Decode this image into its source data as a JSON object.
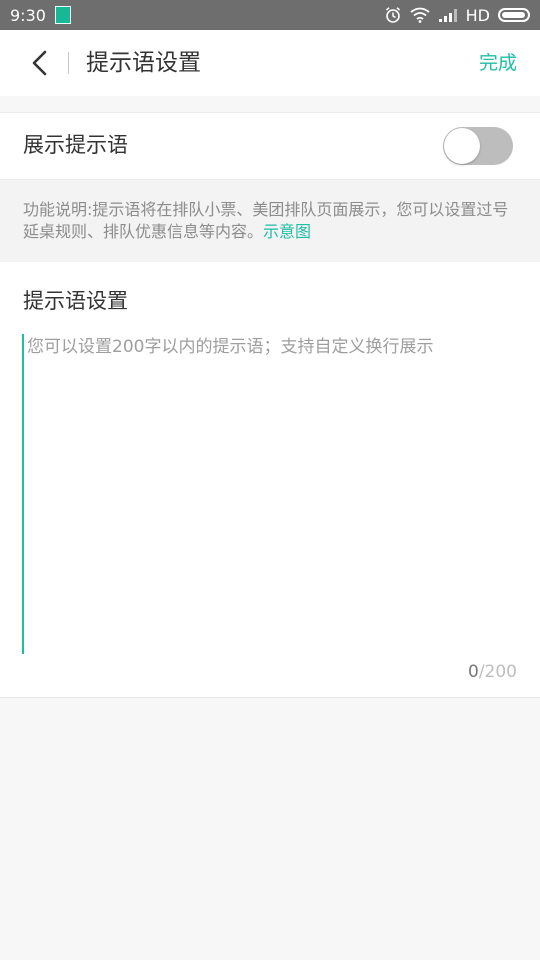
{
  "status_bar": {
    "time": "9:30",
    "network": "HD"
  },
  "nav": {
    "title": "提示语设置",
    "done_label": "完成"
  },
  "toggle_row": {
    "label": "展示提示语",
    "enabled": false
  },
  "description": {
    "text": "功能说明:提示语将在排队小票、美团排队页面展示，您可以设置过号延桌规则、排队优惠信息等内容。",
    "link_label": "示意图"
  },
  "editor": {
    "title": "提示语设置",
    "placeholder": "您可以设置200字以内的提示语；支持自定义换行展示",
    "value": "",
    "count_current": "0",
    "count_max": "/200"
  },
  "colors": {
    "accent": "#1ebea5",
    "status_bar": "#6e6e6e",
    "switch_off": "#bdbdbd"
  }
}
